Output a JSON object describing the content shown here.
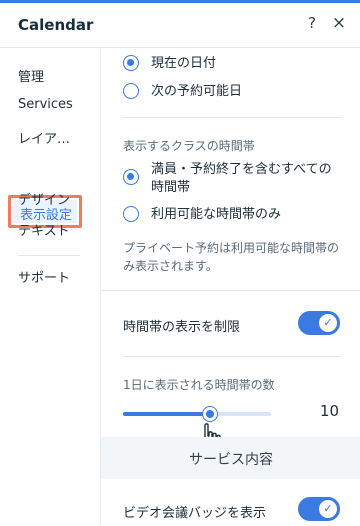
{
  "header": {
    "title": "Calendar",
    "help_label": "?",
    "close_label": "×"
  },
  "sidebar": {
    "items": [
      {
        "label": "管理"
      },
      {
        "label": "Services"
      },
      {
        "label": "レイア…"
      },
      {
        "label": "表示設定"
      },
      {
        "label": "デザイン"
      },
      {
        "label": "テキスト"
      },
      {
        "label": "サポート"
      }
    ],
    "selected_index": 3
  },
  "main": {
    "date_options": [
      {
        "label": "現在の日付",
        "selected": true
      },
      {
        "label": "次の予約可能日",
        "selected": false
      }
    ],
    "class_time_label": "表示するクラスの時間帯",
    "class_time_options": [
      {
        "label": "満員・予約終了を含むすべての時間帯",
        "selected": true
      },
      {
        "label": "利用可能な時間帯のみ",
        "selected": false
      }
    ],
    "private_hint": "プライベート予約は利用可能な時間帯のみ表示されます。",
    "limit_label": "時間帯の表示を制限",
    "limit_enabled": true,
    "per_day_label": "1日に表示される時間帯の数",
    "per_day_value": "10",
    "per_day_fraction": 0.59,
    "service_section_title": "サービス内容",
    "video_badge_label": "ビデオ会議バッジを表示",
    "video_badge_enabled": true
  },
  "colors": {
    "accent": "#3b7ae0",
    "highlight_border": "#f07b63"
  }
}
